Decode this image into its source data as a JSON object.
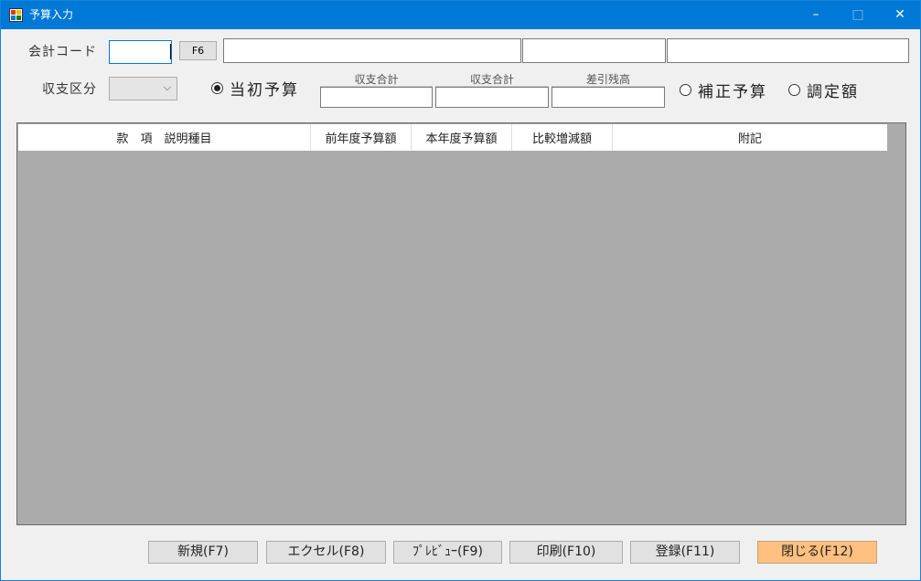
{
  "window": {
    "title": "予算入力"
  },
  "controls": {
    "minimize": "–",
    "maximize": "□",
    "close": "✕"
  },
  "header": {
    "account_code_label": "会計コード",
    "f6_label": "F6",
    "category_label": "収支区分",
    "category_value": "",
    "radio_initial": "当初予算",
    "radio_revised": "補正予算",
    "radio_adjust": "調定額",
    "sum1_label": "収支合計",
    "sum2_label": "収支合計",
    "balance_label": "差引残高"
  },
  "table": {
    "columns": [
      "款　項　説明種目",
      "前年度予算額",
      "本年度予算額",
      "比較増減額",
      "附記"
    ]
  },
  "footer": {
    "buttons": [
      "新規(F7)",
      "エクセル(F8)",
      "ﾌﾟﾚﾋﾞｭｰ(F9)",
      "印刷(F10)",
      "登録(F11)",
      "閉じる(F12)"
    ]
  },
  "colors": {
    "titlebar": "#0078d7",
    "accent_button": "#ffc080",
    "grid_bg": "#ababab"
  }
}
